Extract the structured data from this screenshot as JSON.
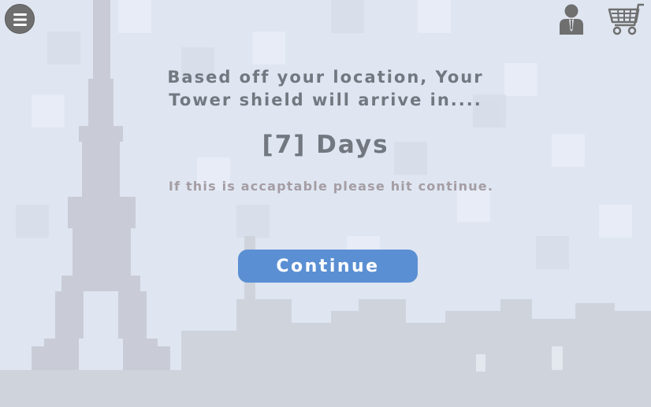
{
  "header": {
    "menu_icon": "hamburger-menu-icon",
    "account_icon": "user-account-icon",
    "cart_icon": "shopping-cart-icon"
  },
  "main": {
    "headline": "Based off your location, Your\nTower shield will arrive in....",
    "delivery_time": "[7] Days",
    "confirm_note": "If this is accaptable please hit continue.",
    "continue_label": "Continue"
  },
  "colors": {
    "background": "#dfe6f1",
    "skyline": "#c9ccd6",
    "text_primary": "#727780",
    "text_note": "#a59da4",
    "button": "#5b8fd3",
    "icon": "#6f6f6f"
  }
}
